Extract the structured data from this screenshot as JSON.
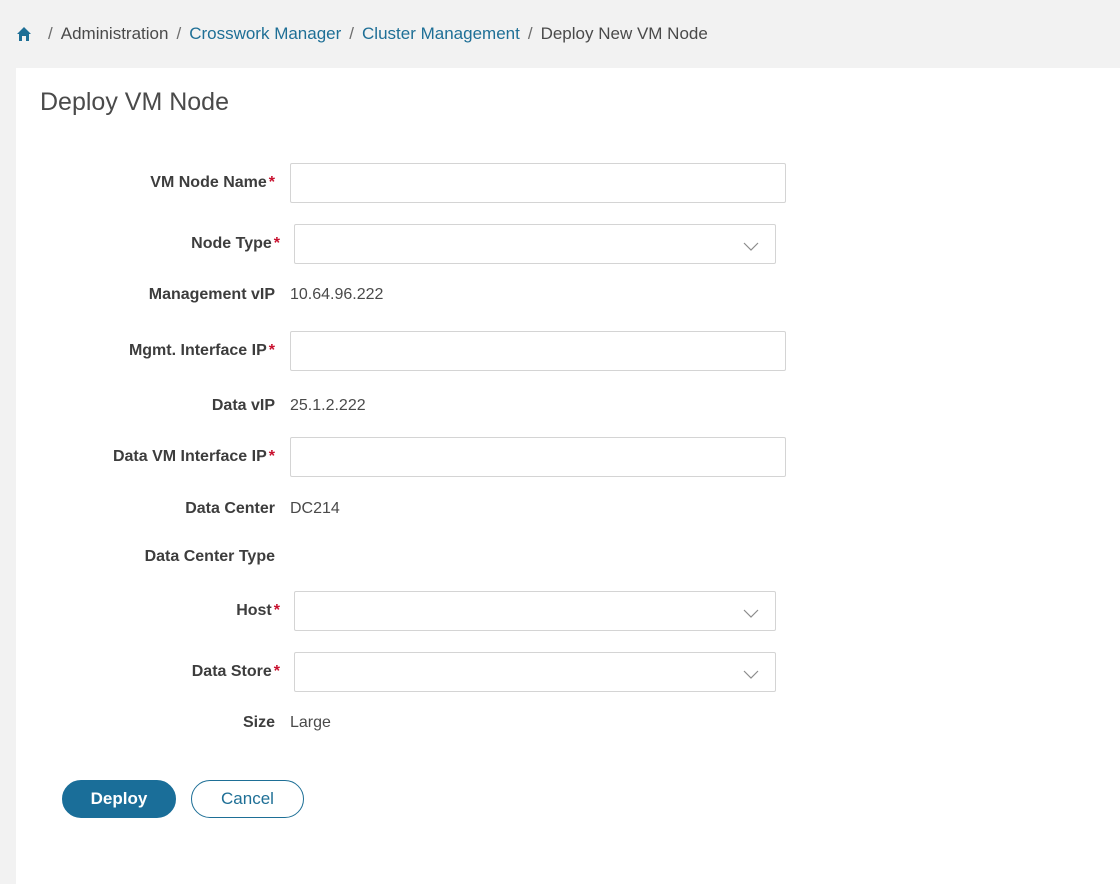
{
  "breadcrumb": {
    "home_icon": "home-icon",
    "separator": "/",
    "items": [
      {
        "label": "Administration",
        "link": false
      },
      {
        "label": "Crosswork Manager",
        "link": true
      },
      {
        "label": "Cluster Management",
        "link": true
      },
      {
        "label": "Deploy New VM Node",
        "link": false
      }
    ]
  },
  "page": {
    "title": "Deploy VM Node"
  },
  "form": {
    "required_marker": "*",
    "vm_node_name": {
      "label": "VM Node Name",
      "value": "",
      "placeholder": ""
    },
    "node_type": {
      "label": "Node Type",
      "selected": ""
    },
    "management_vip": {
      "label": "Management vIP",
      "value": "10.64.96.222"
    },
    "mgmt_interface_ip": {
      "label": "Mgmt. Interface IP",
      "value": "",
      "placeholder": ""
    },
    "data_vip": {
      "label": "Data vIP",
      "value": "25.1.2.222"
    },
    "data_vm_interface_ip": {
      "label": "Data VM Interface IP",
      "value": "",
      "placeholder": ""
    },
    "data_center": {
      "label": "Data Center",
      "value": "DC214"
    },
    "data_center_type": {
      "label": "Data Center Type",
      "value": ""
    },
    "host": {
      "label": "Host",
      "selected": ""
    },
    "data_store": {
      "label": "Data Store",
      "selected": ""
    },
    "size": {
      "label": "Size",
      "value": "Large"
    }
  },
  "actions": {
    "deploy_label": "Deploy",
    "cancel_label": "Cancel"
  },
  "colors": {
    "accent": "#1a6e99",
    "link": "#1e6f96",
    "required": "#c8102e"
  }
}
